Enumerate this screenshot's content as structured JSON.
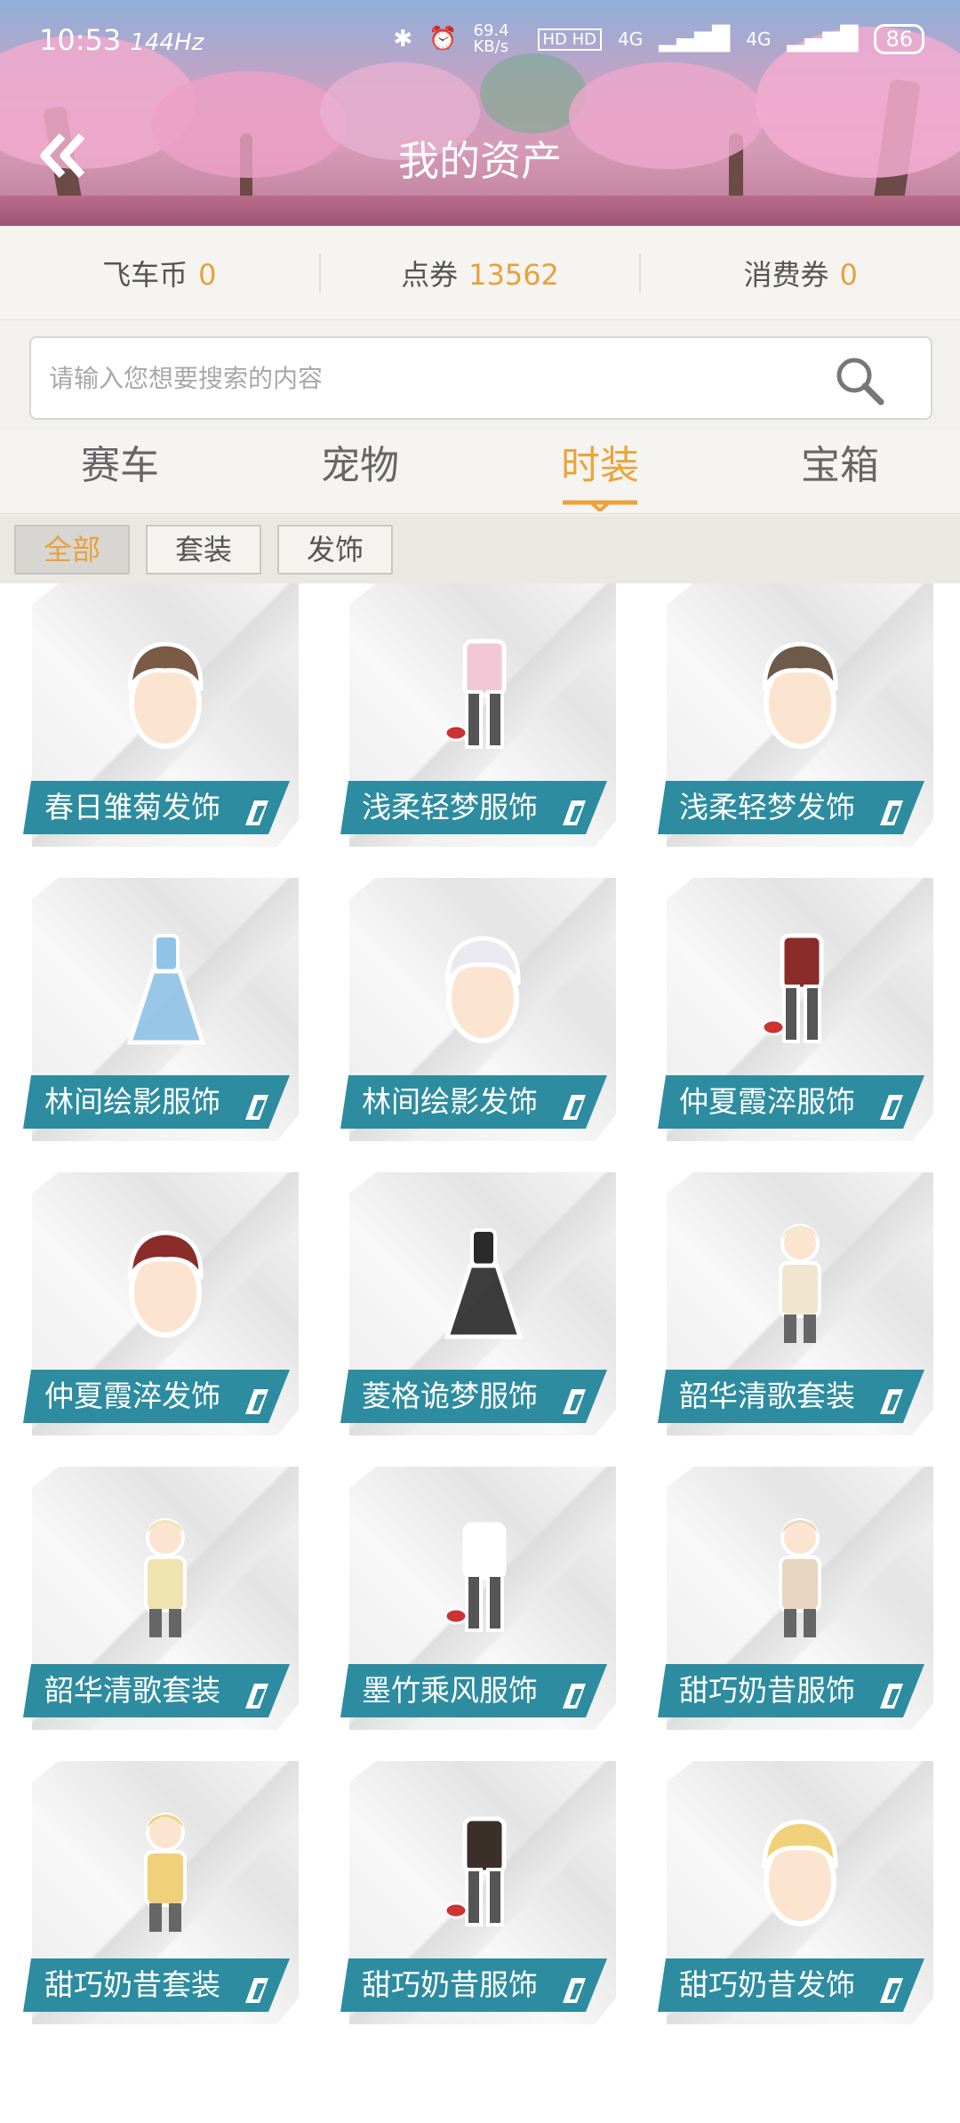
{
  "status_bar": {
    "time": "10:53",
    "refresh": "144Hz",
    "speed": "69.4 KB/s",
    "hd": "HD HD",
    "net1": "4G",
    "net2": "4G",
    "battery": "86"
  },
  "header": {
    "title": "我的资产"
  },
  "assets": [
    {
      "label": "飞车币",
      "value": "0"
    },
    {
      "label": "点券",
      "value": "13562"
    },
    {
      "label": "消费券",
      "value": "0"
    }
  ],
  "search": {
    "placeholder": "请输入您想要搜索的内容"
  },
  "tabs": [
    {
      "label": "赛车"
    },
    {
      "label": "宠物"
    },
    {
      "label": "时装"
    },
    {
      "label": "宝箱"
    }
  ],
  "filters": [
    {
      "label": "全部"
    },
    {
      "label": "套装"
    },
    {
      "label": "发饰"
    }
  ],
  "items": [
    {
      "name": "春日雏菊发饰"
    },
    {
      "name": "浅柔轻梦服饰"
    },
    {
      "name": "浅柔轻梦发饰"
    },
    {
      "name": "林间绘影服饰"
    },
    {
      "name": "林间绘影发饰"
    },
    {
      "name": "仲夏霞淬服饰"
    },
    {
      "name": "仲夏霞淬发饰"
    },
    {
      "name": "菱格诡梦服饰"
    },
    {
      "name": "韶华清歌套装"
    },
    {
      "name": "韶华清歌套装"
    },
    {
      "name": "墨竹乘风服饰"
    },
    {
      "name": "甜巧奶昔服饰"
    },
    {
      "name": "甜巧奶昔套装"
    },
    {
      "name": "甜巧奶昔服饰"
    },
    {
      "name": "甜巧奶昔发饰"
    }
  ],
  "colors": {
    "accent": "#eaa43b",
    "label_bg": "#2d8ca0"
  }
}
